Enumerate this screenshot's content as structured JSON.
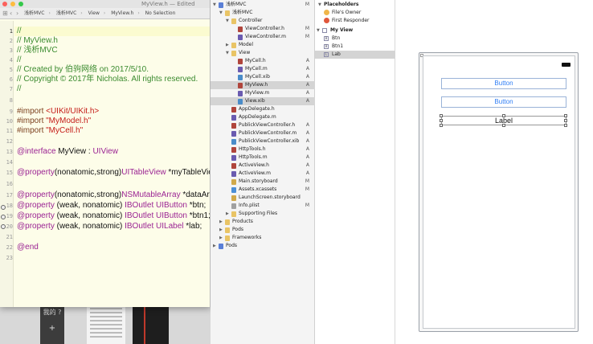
{
  "editor": {
    "title": "MyView.h — Edited",
    "breadcrumbs": [
      "浅析MVC",
      "浅析MVC",
      "View",
      "MyView.h",
      "No Selection"
    ],
    "line_numbers": [
      "1",
      "2",
      "3",
      "4",
      "5",
      "6",
      "7",
      "8",
      "9",
      "10",
      "11",
      "12",
      "13",
      "14",
      "15",
      "16",
      "17",
      "18",
      "19",
      "20",
      "21",
      "22",
      "23"
    ],
    "code": {
      "l1": "//",
      "l2": "//  MyView.h",
      "l3": "//  浅析MVC",
      "l4": "//",
      "l5": "//  Created by 伯驹网络 on 2017/5/10.",
      "l6": "//  Copyright © 2017年 Nicholas. All rights reserved.",
      "l7": "//",
      "l9a": "#import ",
      "l9b": "<UIKit/UIKit.h>",
      "l10a": "#import ",
      "l10b": "\"MyModel.h\"",
      "l11a": "#import ",
      "l11b": "\"MyCell.h\"",
      "l13a": "@interface",
      "l13b": " MyView : ",
      "l13c": "UIView",
      "l15a": "@property",
      "l15b": "(nonatomic,strong)",
      "l15c": "UITableView",
      "l15d": " *myTableView;",
      "l17a": "@property",
      "l17b": "(nonatomic,strong)",
      "l17c": "NSMutableArray",
      "l17d": " *dataAry;",
      "l18a": "@property",
      "l18b": " (weak, nonatomic) ",
      "l18c": "IBOutlet",
      "l18d": " UIButton",
      "l18e": " *btn;",
      "l19a": "@property",
      "l19b": " (weak, nonatomic) ",
      "l19c": "IBOutlet",
      "l19d": " UIButton",
      "l19e": " *btn1;",
      "l20a": "@property",
      "l20b": " (weak, nonatomic) ",
      "l20c": "IBOutlet",
      "l20d": " UILabel",
      "l20e": " *lab;",
      "l22": "@end"
    }
  },
  "desktop": {
    "fragment": "我的 ?",
    "overlay": "+"
  },
  "navigator": {
    "rows": [
      {
        "label": "浅析MVC",
        "badge": "M",
        "indent": 0,
        "icon": "blue",
        "tri": "▼",
        "sel": false
      },
      {
        "label": "浅析MVC",
        "badge": "",
        "indent": 1,
        "icon": "folder",
        "tri": "▼",
        "sel": false
      },
      {
        "label": "Controller",
        "badge": "",
        "indent": 2,
        "icon": "folder",
        "tri": "▼",
        "sel": false
      },
      {
        "label": "ViewController.h",
        "badge": "M",
        "indent": 3,
        "icon": "h",
        "tri": "",
        "sel": false
      },
      {
        "label": "ViewController.m",
        "badge": "M",
        "indent": 3,
        "icon": "m",
        "tri": "",
        "sel": false
      },
      {
        "label": "Model",
        "badge": "",
        "indent": 2,
        "icon": "folder",
        "tri": "▶",
        "sel": false
      },
      {
        "label": "View",
        "badge": "",
        "indent": 2,
        "icon": "folder",
        "tri": "▼",
        "sel": false
      },
      {
        "label": "MyCell.h",
        "badge": "A",
        "indent": 3,
        "icon": "h",
        "tri": "",
        "sel": false
      },
      {
        "label": "MyCell.m",
        "badge": "A",
        "indent": 3,
        "icon": "m",
        "tri": "",
        "sel": false
      },
      {
        "label": "MyCell.xib",
        "badge": "A",
        "indent": 3,
        "icon": "xib",
        "tri": "",
        "sel": false
      },
      {
        "label": "MyView.h",
        "badge": "A",
        "indent": 3,
        "icon": "h",
        "tri": "",
        "sel": true
      },
      {
        "label": "MyView.m",
        "badge": "A",
        "indent": 3,
        "icon": "m",
        "tri": "",
        "sel": false
      },
      {
        "label": "View.xib",
        "badge": "A",
        "indent": 3,
        "icon": "xib",
        "tri": "",
        "sel": true
      },
      {
        "label": "AppDelegate.h",
        "badge": "",
        "indent": 2,
        "icon": "h",
        "tri": "",
        "sel": false
      },
      {
        "label": "AppDelegate.m",
        "badge": "",
        "indent": 2,
        "icon": "m",
        "tri": "",
        "sel": false
      },
      {
        "label": "PublickViewController.h",
        "badge": "A",
        "indent": 2,
        "icon": "h",
        "tri": "",
        "sel": false
      },
      {
        "label": "PublickViewController.m",
        "badge": "A",
        "indent": 2,
        "icon": "m",
        "tri": "",
        "sel": false
      },
      {
        "label": "PublickViewController.xib",
        "badge": "A",
        "indent": 2,
        "icon": "xib",
        "tri": "",
        "sel": false
      },
      {
        "label": "HttpTools.h",
        "badge": "A",
        "indent": 2,
        "icon": "h",
        "tri": "",
        "sel": false
      },
      {
        "label": "HttpTools.m",
        "badge": "A",
        "indent": 2,
        "icon": "m",
        "tri": "",
        "sel": false
      },
      {
        "label": "ActiveView.h",
        "badge": "A",
        "indent": 2,
        "icon": "h",
        "tri": "",
        "sel": false
      },
      {
        "label": "ActiveView.m",
        "badge": "A",
        "indent": 2,
        "icon": "m",
        "tri": "",
        "sel": false
      },
      {
        "label": "Main.storyboard",
        "badge": "M",
        "indent": 2,
        "icon": "story",
        "tri": "",
        "sel": false
      },
      {
        "label": "Assets.xcassets",
        "badge": "M",
        "indent": 2,
        "icon": "assets",
        "tri": "",
        "sel": false
      },
      {
        "label": "LaunchScreen.storyboard",
        "badge": "",
        "indent": 2,
        "icon": "story",
        "tri": "",
        "sel": false
      },
      {
        "label": "Info.plist",
        "badge": "M",
        "indent": 2,
        "icon": "plist",
        "tri": "",
        "sel": false
      },
      {
        "label": "Supporting Files",
        "badge": "",
        "indent": 2,
        "icon": "folder",
        "tri": "▶",
        "sel": false
      },
      {
        "label": "Products",
        "badge": "",
        "indent": 1,
        "icon": "folder",
        "tri": "▶",
        "sel": false
      },
      {
        "label": "Pods",
        "badge": "",
        "indent": 1,
        "icon": "folder",
        "tri": "▶",
        "sel": false
      },
      {
        "label": "Frameworks",
        "badge": "",
        "indent": 1,
        "icon": "folder",
        "tri": "▶",
        "sel": false
      },
      {
        "label": "Pods",
        "badge": "",
        "indent": 0,
        "icon": "blue",
        "tri": "▶",
        "sel": false
      }
    ]
  },
  "outline": {
    "placeholders_header": "Placeholders",
    "files_owner": "File's Owner",
    "first_responder": "First Responder",
    "myview_header": "My View",
    "items": [
      {
        "label": "Btn",
        "mark": "B",
        "sel": false
      },
      {
        "label": "Btn1",
        "mark": "B",
        "sel": false
      },
      {
        "label": "Lab",
        "mark": "L",
        "sel": true
      }
    ]
  },
  "canvas": {
    "button1_label": "Button",
    "button2_label": "Button",
    "label_text": "Label"
  },
  "colors": {
    "editor_bg": "#fdfde9",
    "comment": "#3b8b2f",
    "keyword": "#9b2393",
    "string": "#c41a16",
    "preprocessor": "#7b3f1d",
    "type": "#3f6e74",
    "button_text": "#2f7ef6"
  }
}
